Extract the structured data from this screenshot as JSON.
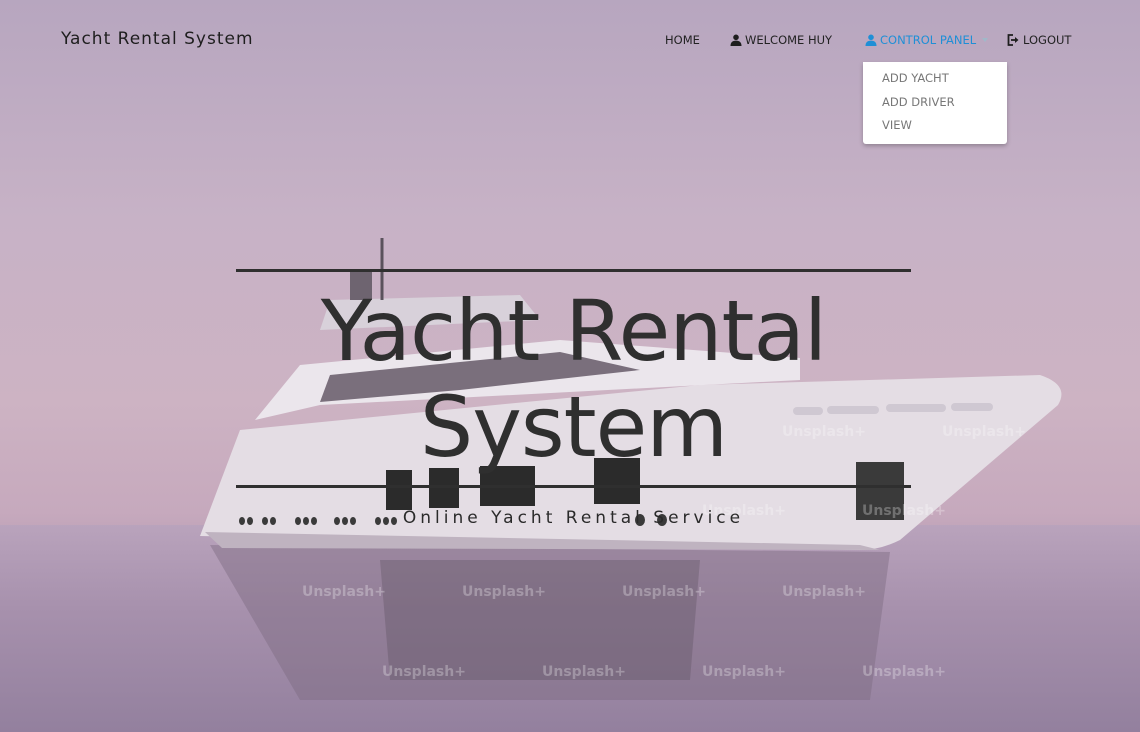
{
  "brand": "Yacht Rental System",
  "nav": {
    "home": "HOME",
    "welcome": "WELCOME HUY",
    "control_panel": "CONTROL PANEL",
    "logout": "LOGOUT"
  },
  "dropdown": {
    "items": [
      "ADD YACHT",
      "ADD DRIVER",
      "VIEW"
    ]
  },
  "hero": {
    "title_line1": "Yacht Rental",
    "title_line2": "System",
    "subtitle": "Online Yacht Rental Service"
  },
  "watermark": "Unsplash+",
  "icons": {
    "user": "user-icon",
    "logout": "logout-icon",
    "caret": "caret-down-icon"
  },
  "colors": {
    "active_nav": "#1f8fd6",
    "text": "#2f2f2f",
    "dropdown_bg": "#ffffff"
  }
}
